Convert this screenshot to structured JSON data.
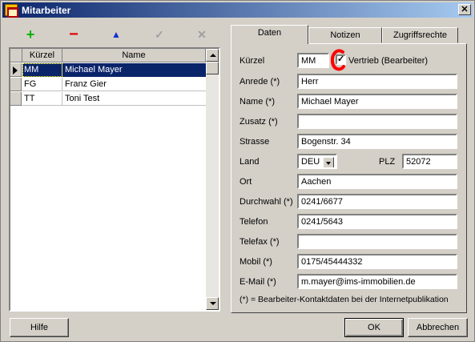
{
  "window": {
    "title": "Mitarbeiter",
    "close_glyph": "✕",
    "icon": "app-building-icon"
  },
  "toolbar": {
    "add_glyph": "+",
    "delete_glyph": "−",
    "move_up_glyph": "▲",
    "confirm_glyph": "✓",
    "cancel_glyph": "✕"
  },
  "table": {
    "columns": [
      "Kürzel",
      "Name"
    ],
    "rows": [
      {
        "kuerzel": "MM",
        "name": "Michael Mayer",
        "selected": true
      },
      {
        "kuerzel": "FG",
        "name": "Franz Gier",
        "selected": false
      },
      {
        "kuerzel": "TT",
        "name": "Toni Test",
        "selected": false
      }
    ]
  },
  "tabs": [
    "Daten",
    "Notizen",
    "Zugriffsrechte"
  ],
  "active_tab": "Daten",
  "form": {
    "kuerzel_label": "Kürzel",
    "kuerzel_value": "MM",
    "vertrieb_label": "Vertrieb (Bearbeiter)",
    "vertrieb_checked": true,
    "check_mark": "✓",
    "anrede_label": "Anrede (*)",
    "anrede_value": "Herr",
    "name_label": "Name (*)",
    "name_value": "Michael Mayer",
    "zusatz_label": "Zusatz (*)",
    "zusatz_value": "",
    "strasse_label": "Strasse",
    "strasse_value": "Bogenstr. 34",
    "land_label": "Land",
    "land_value": "DEU",
    "plz_label": "PLZ",
    "plz_value": "52072",
    "ort_label": "Ort",
    "ort_value": "Aachen",
    "durchwahl_label": "Durchwahl (*)",
    "durchwahl_value": "0241/6677",
    "telefon_label": "Telefon",
    "telefon_value": "0241/5643",
    "telefax_label": "Telefax (*)",
    "telefax_value": "",
    "mobil_label": "Mobil (*)",
    "mobil_value": "0175/45444332",
    "email_label": "E-Mail (*)",
    "email_value": "m.mayer@ims-immobilien.de",
    "footnote": "(*)  =  Bearbeiter-Kontaktdaten bei der Internetpublikation"
  },
  "buttons": {
    "help": "Hilfe",
    "ok": "OK",
    "cancel": "Abbrechen"
  },
  "colors": {
    "selection": "#0a246a",
    "annotation": "#ff0000",
    "add": "#00b000",
    "delete": "#e00000",
    "up": "#1030d0"
  }
}
